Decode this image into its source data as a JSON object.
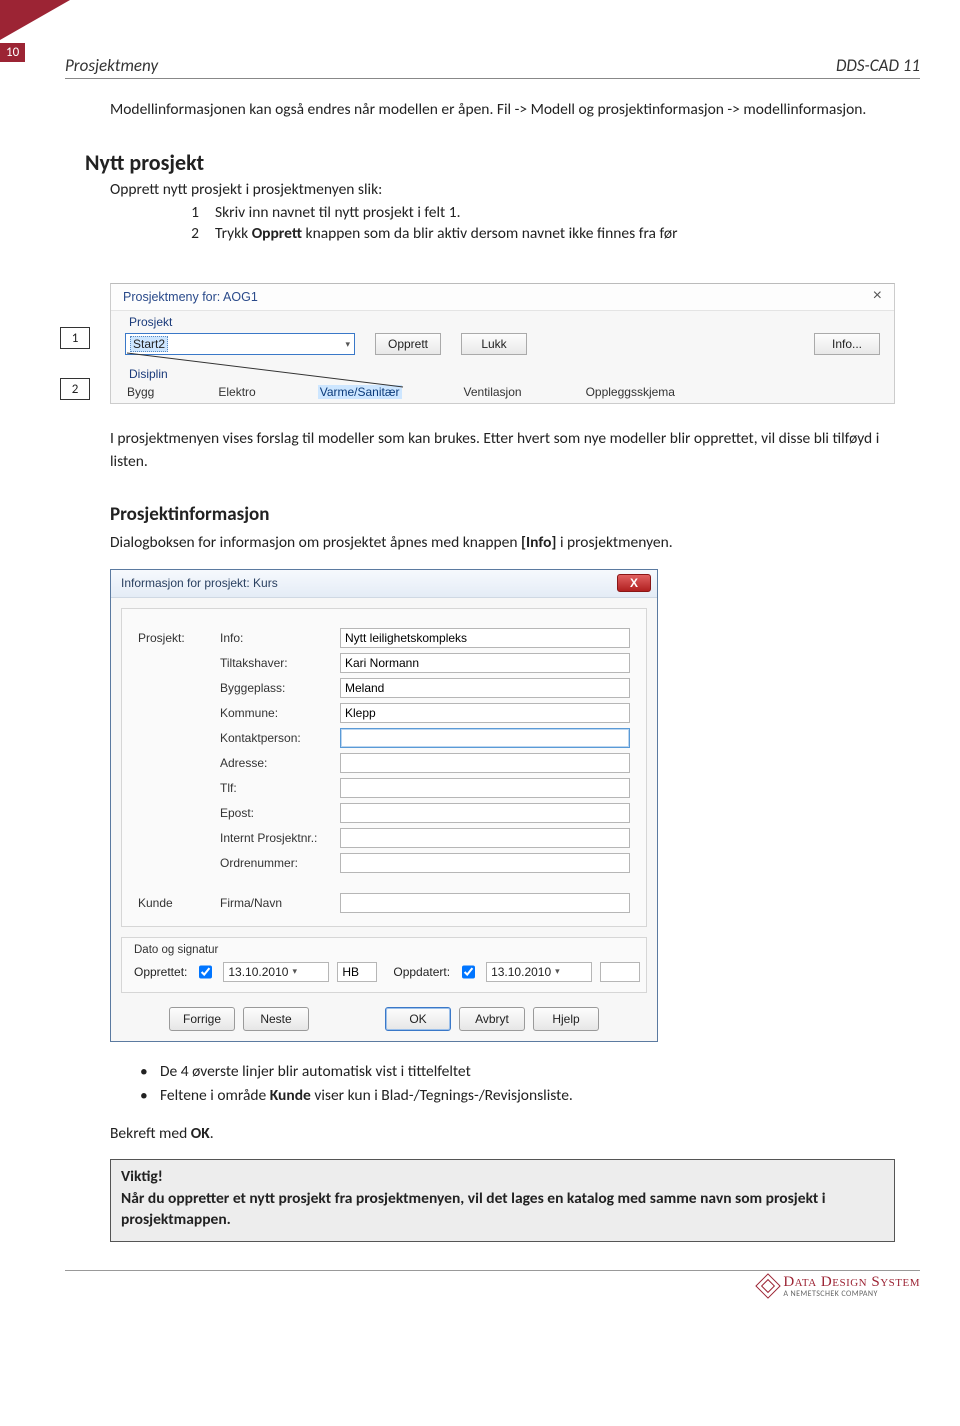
{
  "page_number": "10",
  "header_left": "Prosjektmeny",
  "header_right": "DDS-CAD 11",
  "intro_para": "Modellinformasjonen kan også endres når modellen er åpen. Fil -> Modell og prosjektinformasjon -> modellinformasjon.",
  "h2": "Nytt prosjekt",
  "sub": "Opprett nytt prosjekt i prosjektmenyen slik:",
  "steps": [
    {
      "n": "1",
      "text": "Skriv inn navnet til nytt prosjekt i felt 1."
    },
    {
      "n": "2",
      "text_a": "Trykk ",
      "text_bold": "Opprett",
      "text_b": " knappen som da blir aktiv dersom navnet ikke finnes fra før"
    }
  ],
  "marker1": "1",
  "marker2": "2",
  "dlg1": {
    "title": "Prosjektmeny for: AOG1",
    "grp_prosjekt": "Prosjekt",
    "combo_value": "Start2",
    "btn_opprett": "Opprett",
    "btn_lukk": "Lukk",
    "btn_info": "Info...",
    "grp_disiplin": "Disiplin",
    "tabs": [
      "Bygg",
      "Elektro",
      "Varme/Sanitær",
      "Ventilasjon",
      "Oppleggsskjema"
    ],
    "active_tab": "Varme/Sanitær"
  },
  "after_fig": "I prosjektmenyen vises forslag til modeller som kan brukes. Etter hvert som nye modeller blir opprettet, vil disse bli tilføyd i listen.",
  "h3": "Prosjektinformasjon",
  "h3_para_a": "Dialogboksen for informasjon om prosjektet åpnes med knappen ",
  "h3_para_bold": "[Info]",
  "h3_para_b": " i prosjektmenyen.",
  "dlg2": {
    "title": "Informasjon for prosjekt:  Kurs",
    "col1_label": "Prosjekt:",
    "fields": [
      {
        "label": "Info:",
        "value": "Nytt leilighetskompleks"
      },
      {
        "label": "Tiltakshaver:",
        "value": "Kari Normann"
      },
      {
        "label": "Byggeplass:",
        "value": "Meland"
      },
      {
        "label": "Kommune:",
        "value": "Klepp"
      },
      {
        "label": "Kontaktperson:",
        "value": ""
      },
      {
        "label": "Adresse:",
        "value": ""
      },
      {
        "label": "Tlf:",
        "value": ""
      },
      {
        "label": "Epost:",
        "value": ""
      },
      {
        "label": "Internt Prosjektnr.:",
        "value": ""
      },
      {
        "label": "Ordrenummer:",
        "value": ""
      }
    ],
    "kunde_label": "Kunde",
    "kunde_field_label": "Firma/Navn",
    "sig_legend": "Dato og signatur",
    "opprettet_label": "Opprettet:",
    "opprettet_date": "13.10.2010",
    "opprettet_init": "HB",
    "oppdatert_label": "Oppdatert:",
    "oppdatert_date": "13.10.2010",
    "btn_forrige": "Forrige",
    "btn_neste": "Neste",
    "btn_ok": "OK",
    "btn_avbryt": "Avbryt",
    "btn_hjelp": "Hjelp"
  },
  "bullets": [
    "De 4 øverste linjer blir automatisk vist i tittelfeltet",
    "Feltene i område Kunde viser kun i Blad-/Tegnings-/Revisjonsliste."
  ],
  "bullet2_bold": "Kunde",
  "confirm_a": "Bekreft med ",
  "confirm_bold": "OK",
  "confirm_b": ".",
  "important_title": "Viktig!",
  "important_body": "Når du oppretter et nytt prosjekt fra prosjektmenyen, vil det lages en katalog med samme navn som prosjekt i prosjektmappen.",
  "footer_brand": "Data Design System",
  "footer_sub": "A NEMETSCHEK COMPANY"
}
